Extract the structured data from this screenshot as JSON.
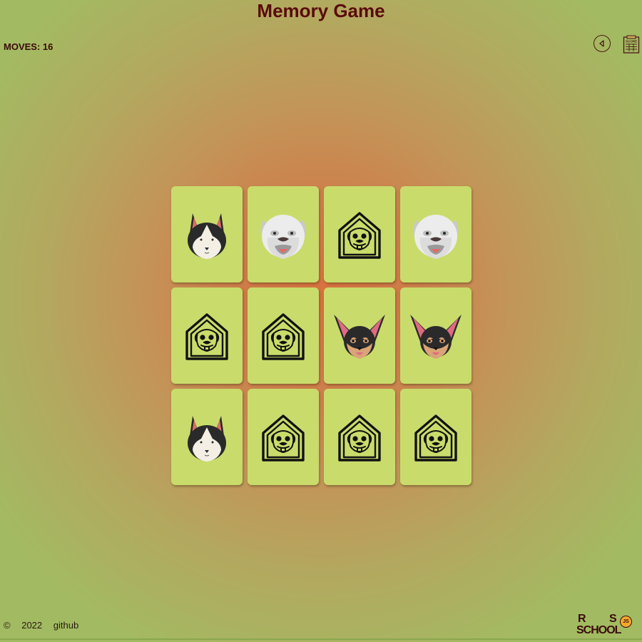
{
  "app": {
    "title": "Memory Game"
  },
  "status": {
    "moves_label": "MOVES: 16"
  },
  "toolbar": {
    "back_icon": "back-triangle-icon",
    "score_icon": "score-notepad-icon",
    "score_icon_text": "SCORE"
  },
  "board": {
    "columns": 4,
    "rows": 3,
    "cards": [
      {
        "face": "husky",
        "state": "revealed"
      },
      {
        "face": "bulldog",
        "state": "revealed"
      },
      {
        "face": "doghouse",
        "state": "hidden"
      },
      {
        "face": "bulldog",
        "state": "revealed"
      },
      {
        "face": "doghouse",
        "state": "hidden"
      },
      {
        "face": "doghouse",
        "state": "hidden"
      },
      {
        "face": "chihuahua",
        "state": "revealed"
      },
      {
        "face": "chihuahua",
        "state": "revealed"
      },
      {
        "face": "husky",
        "state": "revealed"
      },
      {
        "face": "doghouse",
        "state": "hidden"
      },
      {
        "face": "doghouse",
        "state": "hidden"
      },
      {
        "face": "doghouse",
        "state": "hidden"
      }
    ]
  },
  "footer": {
    "copyright": "©",
    "year": "2022",
    "github_link": "github"
  },
  "logo": {
    "line1_left": "R",
    "line1_right": "S",
    "line2": "SCHOOL",
    "badge": "JS"
  },
  "colors": {
    "card": "#c9dc6b",
    "title": "#5a0b0b",
    "center_glow": "#d9713f",
    "edge_green": "#a2bb62"
  }
}
